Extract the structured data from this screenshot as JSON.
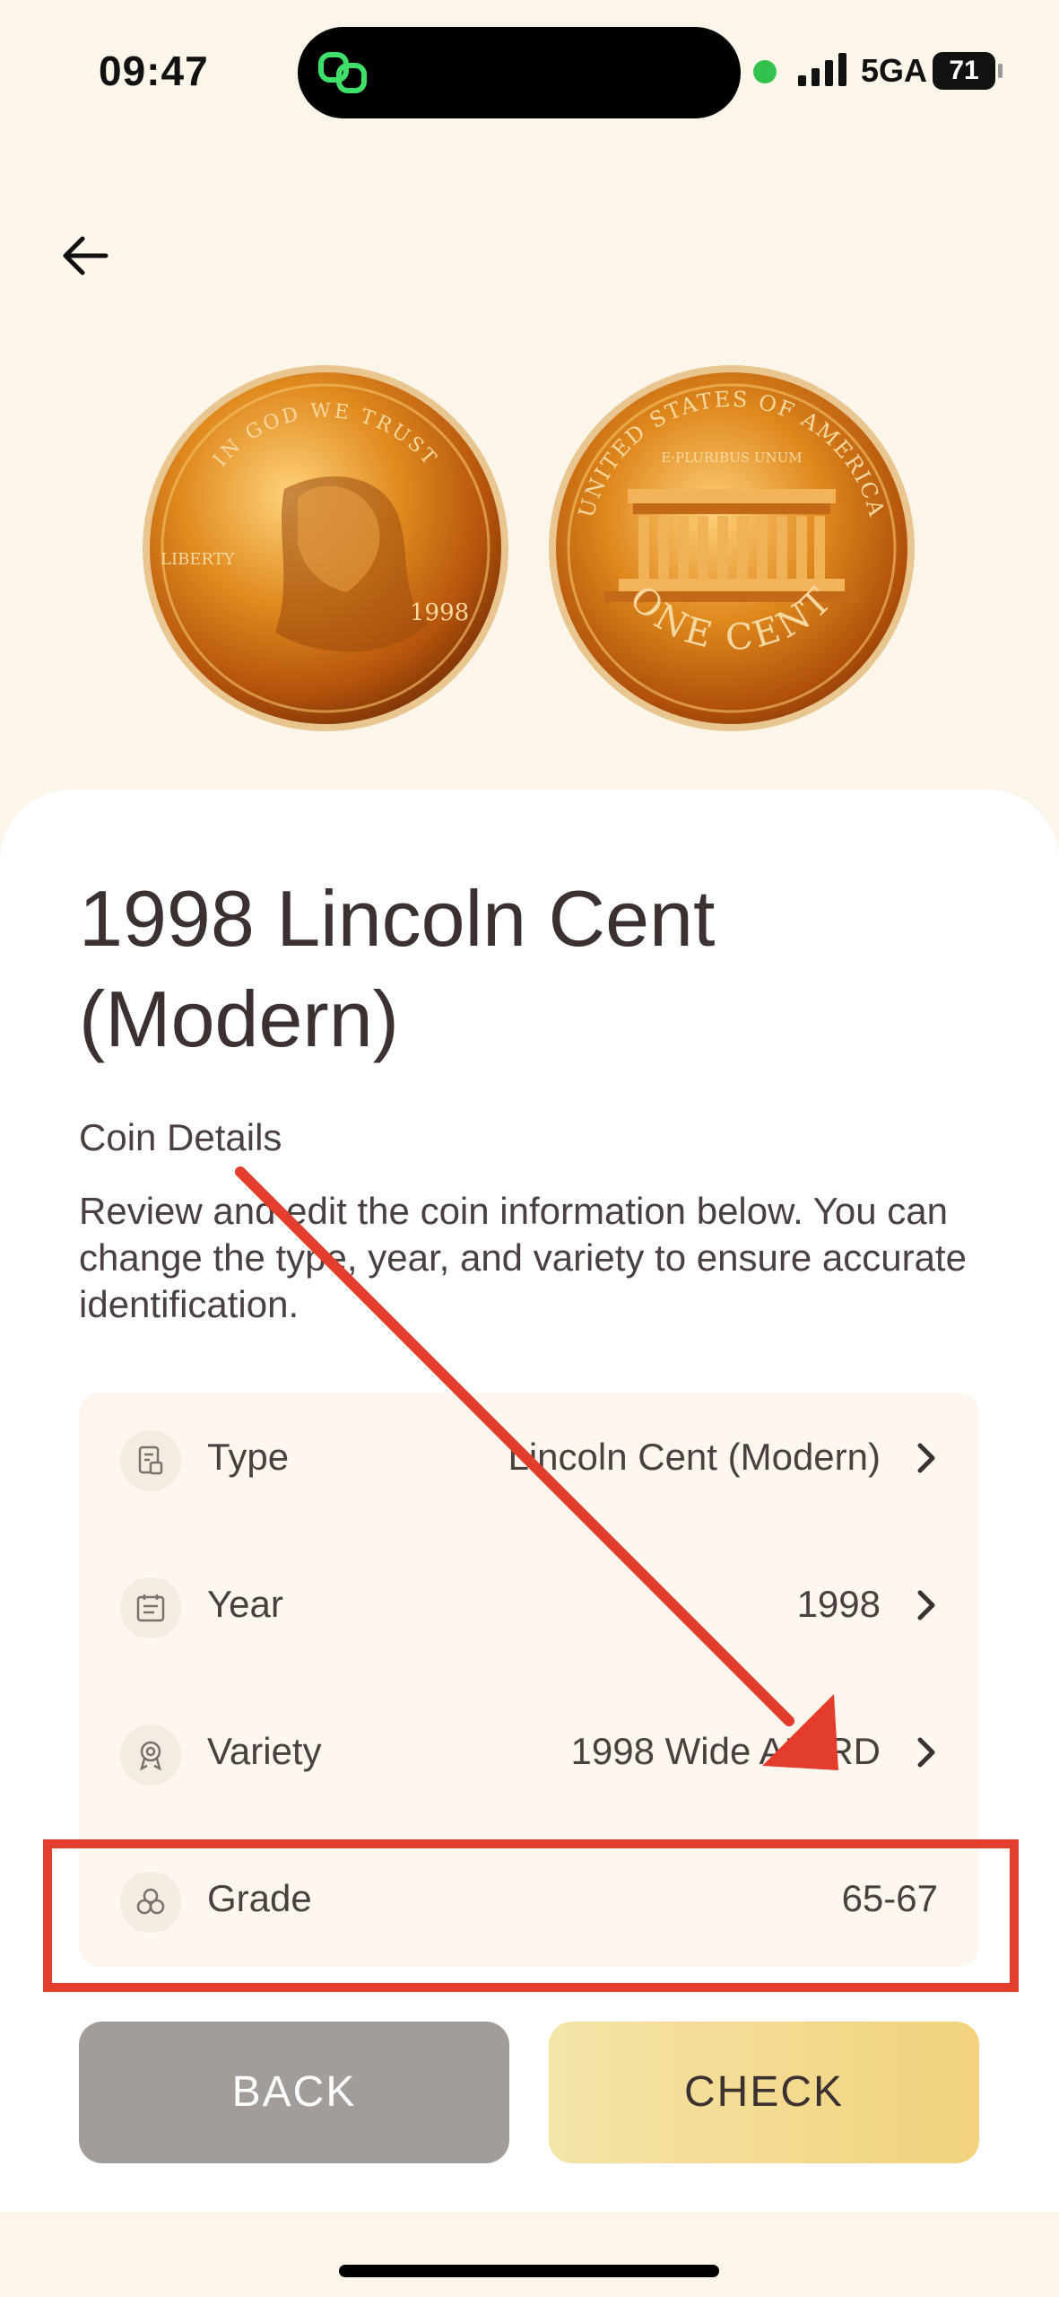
{
  "status_bar": {
    "time": "09:47",
    "network": "5GA",
    "battery": "71"
  },
  "coin": {
    "title": "1998 Lincoln Cent (Modern)",
    "section_label": "Coin Details",
    "description": "Review and edit the coin information below. You can change the type, year, and variety to ensure accurate identification.",
    "front_text": {
      "top": "IN GOD WE TRUST",
      "left": "LIBERTY",
      "year": "1998"
    },
    "back_text": {
      "top": "UNITED STATES OF AMERICA",
      "motto": "E·PLURIBUS UNUM",
      "bottom": "ONE CENT"
    }
  },
  "details": [
    {
      "icon": "document-icon",
      "label": "Type",
      "value": "Lincoln Cent (Modern)"
    },
    {
      "icon": "calendar-icon",
      "label": "Year",
      "value": "1998"
    },
    {
      "icon": "award-icon",
      "label": "Variety",
      "value": "1998 Wide AM RD"
    },
    {
      "icon": "circles-icon",
      "label": "Grade",
      "value": "65-67"
    }
  ],
  "buttons": {
    "back": "BACK",
    "check": "CHECK"
  },
  "colors": {
    "background": "#fcf5ea",
    "annotation": "#e33d2d",
    "check_gradient_start": "#f4e4a8",
    "check_gradient_end": "#f2d27c",
    "back_button": "#a39d9a"
  }
}
